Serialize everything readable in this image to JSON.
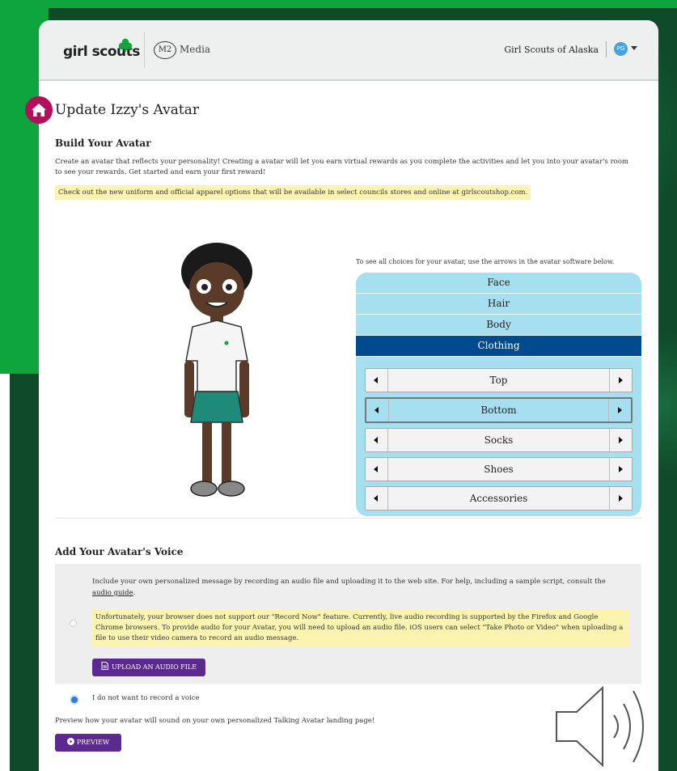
{
  "header": {
    "brand": "girl scouts",
    "media_badge": "M2",
    "media_label": "Media",
    "council": "Girl Scouts of Alaska",
    "user_initials": "PG"
  },
  "page": {
    "title": "Update Izzy's Avatar"
  },
  "build": {
    "heading": "Build Your Avatar",
    "intro": "Create an avatar that reflects your personality!  Creating a avatar will let you earn virtual rewards as you complete the activities and let you into your avatar's room to see your rewards. Get started and earn your first reward!",
    "notice": "Check out the new uniform and official apparel options that will be available in select councils stores and online at girlscoutshop.com.",
    "choices_hint": "To see all choices for your avatar, use the arrows in the avatar software below.",
    "categories": [
      "Face",
      "Hair",
      "Body",
      "Clothing"
    ],
    "active_category": "Clothing",
    "options": [
      "Top",
      "Bottom",
      "Socks",
      "Shoes",
      "Accessories"
    ],
    "selected_option": "Bottom"
  },
  "voice": {
    "heading": "Add Your Avatar's Voice",
    "intro_text": "Include your own personalized message by recording an audio file and uploading it to the web site. For help, including a sample script, consult the ",
    "guide_link": "audio guide",
    "warning": "Unfortunately, your browser does not support our \"Record Now\" feature. Currently, live audio recording is supported by the Firefox and Google Chrome browsers. To provide audio for your Avatar, you will need to upload an audio file. iOS users can select \"Take Photo or Video\" when uploading a file to use their video camera to record an audio message.",
    "upload_label": "UPLOAD AN AUDIO FILE",
    "no_voice_label": "I do not want to record a voice",
    "preview_text": "Preview how your avatar will sound on your own personalized Talking Avatar landing page!",
    "preview_label": "PREVIEW"
  },
  "colors": {
    "brand_green": "#0fa53e",
    "dark_green": "#0f4a2a",
    "accent_purple": "#5c2a8e",
    "home_magenta": "#b3105b",
    "picker_blue": "#a5dff0",
    "active_blue": "#004b8d",
    "notice_yellow": "#fbf4b0"
  }
}
